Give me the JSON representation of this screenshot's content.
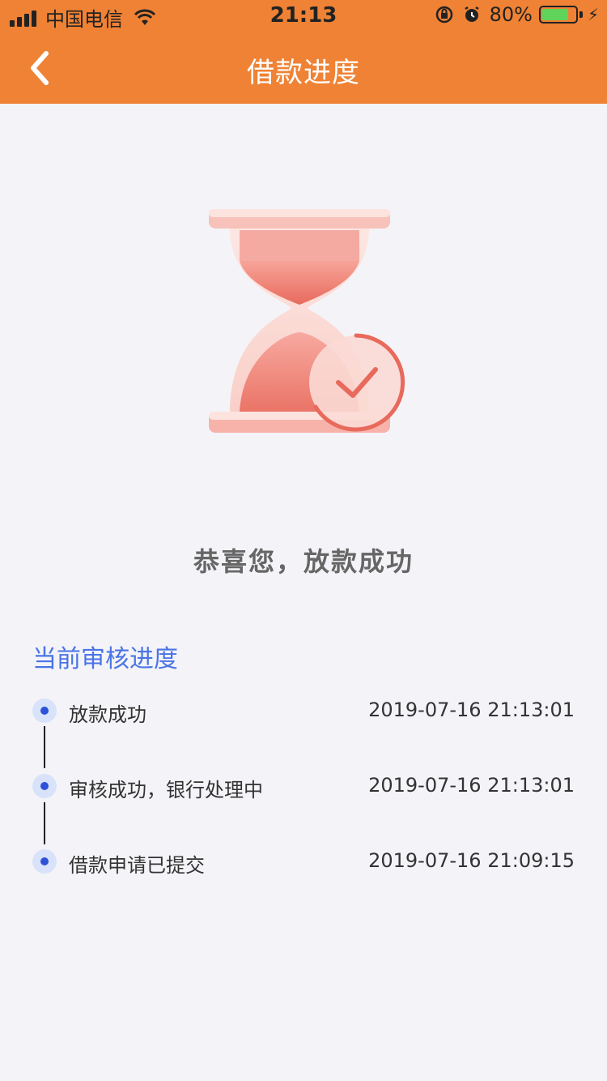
{
  "status_bar": {
    "carrier": "中国电信",
    "time": "21:13",
    "battery": "80%"
  },
  "nav": {
    "title": "借款进度",
    "back_icon": "chevron-left-icon"
  },
  "result": {
    "icon": "hourglass-check-icon",
    "message": "恭喜您，放款成功"
  },
  "progress": {
    "title": "当前审核进度",
    "steps": [
      {
        "label": "放款成功",
        "time": "2019-07-16 21:13:01"
      },
      {
        "label": "审核成功，银行处理中",
        "time": "2019-07-16 21:13:01"
      },
      {
        "label": "借款申请已提交",
        "time": "2019-07-16 21:09:15"
      }
    ]
  },
  "colors": {
    "header": "#ef8234",
    "accent": "#4a74e6",
    "dot": "#2d52d8"
  }
}
